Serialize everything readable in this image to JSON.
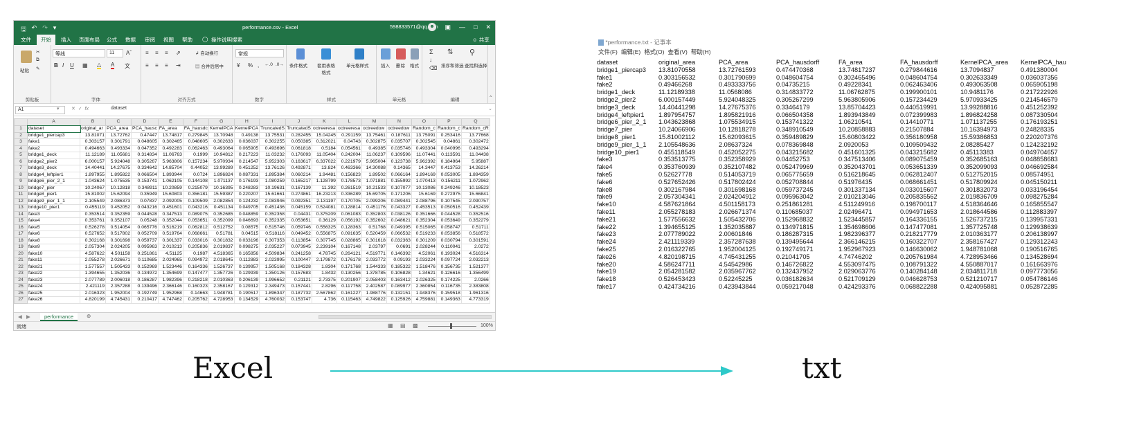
{
  "excel": {
    "title": "performance.csv - Excel",
    "account": "598833571@qq.com",
    "tabs": [
      "文件",
      "开始",
      "插入",
      "页面布局",
      "公式",
      "数据",
      "审阅",
      "视图",
      "帮助"
    ],
    "tell_me": "操作说明搜索",
    "share": "共享",
    "ribbon": {
      "paste": "粘贴",
      "font_name": "等线",
      "font_size": "11",
      "wrap_text": "自动换行",
      "merge_center": "合并后居中",
      "number_format": "常规",
      "conditional_format": "条件格式",
      "format_table": "套用表格格式",
      "cell_styles": "单元格样式",
      "insert": "插入",
      "delete": "删除",
      "format": "格式",
      "sort_filter": "排序和筛选",
      "find_select": "查找和选择",
      "groups": [
        "剪贴板",
        "字体",
        "对齐方式",
        "数字",
        "样式",
        "单元格",
        "编辑"
      ]
    },
    "name_box": "A1",
    "fx": "fx",
    "formula_value": "dataset",
    "columns": [
      "A",
      "B",
      "C",
      "D",
      "E",
      "F",
      "G",
      "H",
      "I",
      "J",
      "K",
      "L",
      "M",
      "N",
      "O",
      "P",
      "Q"
    ],
    "rows": [
      [
        "dataset",
        "original_ar",
        "PCA_area",
        "PCA_hausc",
        "FA_area",
        "FA_hausdc",
        "KernelPCA",
        "KernelPCA",
        "TruncatedS",
        "TruncatedS",
        "octreeresa",
        "octreeresa",
        "octreedow",
        "octreedow",
        "Random_c",
        "Random_c",
        "Random_cR"
      ],
      [
        "bridge1_piercap3",
        "13.81071",
        "13.72762",
        "0.47447",
        "13.74817",
        "0.279845",
        "13.70948",
        "0.49138",
        "13.75531",
        "0.282455",
        "15.04245",
        "0.291159",
        "13.75461",
        "0.187611",
        "13.75091",
        "0.253416",
        "13.77668"
      ],
      [
        "fake1",
        "0.303157",
        "0.301791",
        "0.048605",
        "0.302465",
        "0.048605",
        "0.302633",
        "0.036037",
        "0.302255",
        "0.050385",
        "0.312021",
        "0.04743",
        "0.302875",
        "0.035707",
        "0.302545",
        "0.04861",
        "0.302472"
      ],
      [
        "fake2",
        "0.494663",
        "0.493334",
        "0.047352",
        "0.492283",
        "0.062463",
        "0.493064",
        "0.065905",
        "0.493696",
        "0.061818",
        "0.5184",
        "0.054561",
        "0.49385",
        "0.035746",
        "0.493304",
        "0.040996",
        "0.493294"
      ],
      [
        "bridge1_deck",
        "11.12189",
        "11.05681",
        "0.314834",
        "11.06763",
        "0.1999",
        "10.94812",
        "0.217223",
        "11.03232",
        "0.176093",
        "11.05404",
        "0.242004",
        "11.06237",
        "0.109596",
        "11.07441",
        "0.113591",
        "11.04438"
      ],
      [
        "bridge2_pier2",
        "6.000157",
        "5.924048",
        "0.305267",
        "5.963806",
        "0.157234",
        "5.970934",
        "0.214547",
        "5.952303",
        "0.163617",
        "6.337022",
        "0.221979",
        "5.965004",
        "0.123738",
        "5.962392",
        "0.184964",
        "5.95887"
      ],
      [
        "bridge3_deck",
        "14.40441",
        "14.27675",
        "0.334642",
        "14.85704",
        "0.44052",
        "13.99289",
        "0.451252",
        "13.76126",
        "0.492871",
        "13.824",
        "0.463366",
        "14.30088",
        "0.14365",
        "14.3447",
        "0.413753",
        "14.26214"
      ],
      [
        "bridge4_leftpier1",
        "1.897955",
        "1.895822",
        "0.066504",
        "1.893944",
        "0.0724",
        "1.896824",
        "0.087331",
        "1.895384",
        "0.060214",
        "1.94481",
        "0.156823",
        "1.89502",
        "0.066164",
        "1.894169",
        "0.053005",
        "1.894359"
      ],
      [
        "bridge6_pier_2_1",
        "1.043624",
        "1.075535",
        "0.153741",
        "1.062105",
        "0.144108",
        "1.071137",
        "0.176193",
        "1.080259",
        "0.165217",
        "1.128799",
        "0.178573",
        "1.071881",
        "0.155992",
        "1.070413",
        "0.156211",
        "1.072962"
      ],
      [
        "bridge7_pier",
        "10.24067",
        "10.12818",
        "0.348911",
        "10.20859",
        "0.215079",
        "10.16395",
        "0.248283",
        "10.19631",
        "0.167139",
        "11.392",
        "0.261519",
        "10.21533",
        "0.107077",
        "10.13086",
        "0.249246",
        "10.18523"
      ],
      [
        "bridge8_pier1",
        "15.81002",
        "15.62094",
        "0.35949",
        "15.60803",
        "0.356181",
        "15.59387",
        "0.220207",
        "15.61661",
        "0.274861",
        "16.23213",
        "0.336289",
        "15.69705",
        "0.171206",
        "15.6169",
        "0.272975",
        "15.66841"
      ],
      [
        "bridge9_pier_1_1",
        "2.105549",
        "2.086373",
        "0.07837",
        "2.092005",
        "0.109509",
        "2.082854",
        "0.124232",
        "2.083946",
        "0.092351",
        "2.131197",
        "0.170705",
        "2.099206",
        "0.089441",
        "2.088796",
        "0.107545",
        "2.090757"
      ],
      [
        "bridge10_pier1",
        "0.455119",
        "0.452052",
        "0.043216",
        "0.451601",
        "0.043216",
        "0.451134",
        "0.049705",
        "0.451436",
        "0.045159",
        "0.524081",
        "0.128814",
        "0.451176",
        "0.043327",
        "0.453513",
        "0.050516",
        "0.452439"
      ],
      [
        "fake3",
        "0.353514",
        "0.352359",
        "0.044528",
        "0.347513",
        "0.089075",
        "0.352685",
        "0.048859",
        "0.352358",
        "0.04431",
        "0.375209",
        "0.061083",
        "0.352803",
        "0.038126",
        "0.351666",
        "0.044528",
        "0.352516"
      ],
      [
        "fake4",
        "0.353761",
        "0.352107",
        "0.05248",
        "0.352044",
        "0.053651",
        "0.352099",
        "0.046693",
        "0.352335",
        "0.053651",
        "0.36129",
        "0.056192",
        "0.352602",
        "0.048621",
        "0.352304",
        "0.053649",
        "0.352279"
      ],
      [
        "fake5",
        "0.526278",
        "0.514054",
        "0.065776",
        "0.516219",
        "0.062812",
        "0.512752",
        "0.08575",
        "0.515746",
        "0.059746",
        "0.556325",
        "0.128363",
        "0.51768",
        "0.049395",
        "0.515065",
        "0.058747",
        "0.51711"
      ],
      [
        "fake6",
        "0.527652",
        "0.517802",
        "0.052709",
        "0.519764",
        "0.068661",
        "0.51781",
        "0.04515",
        "0.518116",
        "0.049452",
        "0.556875",
        "0.091635",
        "0.520459",
        "0.066532",
        "0.519233",
        "0.053856",
        "0.518572"
      ],
      [
        "fake8",
        "0.302168",
        "0.301698",
        "0.059737",
        "0.301337",
        "0.033016",
        "0.301832",
        "0.033196",
        "0.307353",
        "0.113854",
        "0.307745",
        "0.028865",
        "0.301618",
        "0.032363",
        "0.301209",
        "0.030794",
        "0.301591"
      ],
      [
        "fake9",
        "2.057304",
        "2.024205",
        "0.095963",
        "2.010213",
        "0.205836",
        "2.019837",
        "0.098275",
        "2.035227",
        "0.073945",
        "2.239104",
        "0.167148",
        "2.03797",
        "0.0691",
        "2.028244",
        "0.110041",
        "2.0272"
      ],
      [
        "fake10",
        "4.587622",
        "4.501158",
        "0.251861",
        "4.51125",
        "0.1987",
        "4.518365",
        "0.165856",
        "4.509834",
        "0.241258",
        "4.78745",
        "0.264121",
        "4.519771",
        "0.146392",
        "4.52061",
        "0.193024",
        "4.516314"
      ],
      [
        "fake11",
        "2.055278",
        "2.026671",
        "0.110685",
        "2.024965",
        "0.094972",
        "2.018645",
        "0.112883",
        "2.023995",
        "0.100447",
        "2.179872",
        "0.176178",
        "2.033772",
        "0.09193",
        "2.033224",
        "0.097724",
        "2.032213"
      ],
      [
        "fake21",
        "1.577557",
        "1.505433",
        "0.152969",
        "1.523446",
        "0.164336",
        "1.526737",
        "0.139957",
        "1.505168",
        "0.184328",
        "1.8304",
        "0.171768",
        "1.544333",
        "0.185322",
        "1.518476",
        "0.156735",
        "1.521377"
      ],
      [
        "fake22",
        "1.394655",
        "1.352036",
        "0.134972",
        "1.354699",
        "0.147477",
        "1.357726",
        "0.129939",
        "1.350126",
        "0.157683",
        "1.8432",
        "0.130256",
        "1.378785",
        "0.106828",
        "1.34621",
        "0.126616",
        "1.356499"
      ],
      [
        "fake23",
        "2.077789",
        "2.006018",
        "0.186287",
        "1.982396",
        "0.218218",
        "2.010363",
        "0.206139",
        "1.996652",
        "0.21121",
        "2.73375",
        "0.201907",
        "2.058403",
        "0.163412",
        "2.026325",
        "0.174225",
        "2.0266"
      ],
      [
        "fake24",
        "2.421119",
        "2.357288",
        "0.139496",
        "2.366146",
        "0.160323",
        "2.358167",
        "0.129312",
        "2.349473",
        "0.157441",
        "2.8296",
        "0.117758",
        "2.402587",
        "0.089977",
        "2.360854",
        "0.116735",
        "2.383808"
      ],
      [
        "fake25",
        "2.016323",
        "1.952004",
        "0.192749",
        "1.952968",
        "0.14663",
        "1.948781",
        "0.190517",
        "1.896347",
        "0.187732",
        "2.567862",
        "0.161227",
        "1.988776",
        "0.132151",
        "1.948376",
        "0.159518",
        "1.961316"
      ],
      [
        "fake26",
        "4.820199",
        "4.745431",
        "0.210417",
        "4.747462",
        "0.205762",
        "4.728953",
        "0.134529",
        "4.760032",
        "0.153747",
        "4.736",
        "0.115463",
        "4.749822",
        "0.125926",
        "4.759881",
        "0.149363",
        "4.773319"
      ]
    ],
    "sheet_tab": "performance",
    "status_left": "就绪",
    "zoom": "100%"
  },
  "notepad": {
    "title": "*performance.txt - 记事本",
    "menu": [
      "文件(F)",
      "编辑(E)",
      "格式(O)",
      "查看(V)",
      "帮助(H)"
    ],
    "header": [
      "dataset",
      "original_area",
      "PCA_area",
      "PCA_hausdorff",
      "FA_area",
      "FA_hausdorff",
      "KernelPCA_area",
      "KernelPCA_hau"
    ],
    "rows": [
      [
        "bridge1_piercap3",
        "13.81070558",
        "13.72761593",
        "0.474470368",
        "13.74817237",
        "0.279844616",
        "13.7094837",
        "0.491380004"
      ],
      [
        "fake1",
        "0.303156532",
        "0.301790699",
        "0.048604754",
        "0.302465496",
        "0.048604754",
        "0.302633349",
        "0.036037356"
      ],
      [
        "fake2",
        "0.49466268",
        "0.493333756",
        "0.04735215",
        "0.49228341",
        "0.062463406",
        "0.493063508",
        "0.065905198"
      ],
      [
        "bridge1_deck",
        "11.12189338",
        "11.0568086",
        "0.314833772",
        "11.06762875",
        "0.199900101",
        "10.9481176",
        "0.217222926"
      ],
      [
        "bridge2_pier2",
        "6.000157449",
        "5.924048325",
        "0.305267299",
        "5.963805906",
        "0.157234429",
        "5.970933425",
        "0.214546579"
      ],
      [
        "bridge3_deck",
        "14.40441298",
        "14.27675376",
        "0.33464179",
        "13.85704423",
        "0.440519991",
        "13.99288816",
        "0.451252392"
      ],
      [
        "bridge4_leftpier1",
        "1.897954757",
        "1.895821916",
        "0.066504358",
        "1.893943849",
        "0.072399983",
        "1.896824258",
        "0.087330504"
      ],
      [
        "bridge6_pier_2_1",
        "1.043623868",
        "1.075534915",
        "0.153741322",
        "1.06210541",
        "0.14410771",
        "1.071137255",
        "0.176193251"
      ],
      [
        "bridge7_pier",
        "10.24066906",
        "10.12818278",
        "0.348910549",
        "10.20858883",
        "0.21507884",
        "10.16394973",
        "0.24828335"
      ],
      [
        "bridge8_pier1",
        "15.81002112",
        "15.62093615",
        "0.359489829",
        "15.60803422",
        "0.356180958",
        "15.59386853",
        "0.220207376"
      ],
      [
        "bridge9_pier_1_1",
        "2.105548636",
        "2.08637324",
        "0.078369848",
        "2.0920053",
        "0.109509432",
        "2.08285427",
        "0.124232192"
      ],
      [
        "bridge10_pier1",
        "0.455118549",
        "0.452052275",
        "0.043215682",
        "0.451601325",
        "0.043215682",
        "0.45113383",
        "0.049704657"
      ],
      [
        "fake3",
        "0.353513775",
        "0.352358929",
        "0.04452753",
        "0.347513406",
        "0.089075459",
        "0.352685163",
        "0.048858683"
      ],
      [
        "fake4",
        "0.353760939",
        "0.352107482",
        "0.052479969",
        "0.352043701",
        "0.053651339",
        "0.352099093",
        "0.046692584"
      ],
      [
        "fake5",
        "0.52627778",
        "0.514053719",
        "0.065775659",
        "0.516218645",
        "0.062812407",
        "0.512752015",
        "0.08574951"
      ],
      [
        "fake6",
        "0.527652426",
        "0.517802424",
        "0.052708844",
        "0.51976435",
        "0.068661451",
        "0.517809924",
        "0.045150211"
      ],
      [
        "fake8",
        "0.302167984",
        "0.301698168",
        "0.059737245",
        "0.301337134",
        "0.033015607",
        "0.301832073",
        "0.033196454"
      ],
      [
        "fake9",
        "2.057304341",
        "2.024204912",
        "0.095963042",
        "2.010213046",
        "0.205835562",
        "2.019836709",
        "0.098275284"
      ],
      [
        "fake10",
        "4.587621864",
        "4.501158173",
        "0.251861281",
        "4.511249916",
        "0.198700117",
        "4.518364646",
        "0.165855547"
      ],
      [
        "fake11",
        "2.055278183",
        "2.026671374",
        "0.110685037",
        "2.02496471",
        "0.094971653",
        "2.018644586",
        "0.112883397"
      ],
      [
        "fake21",
        "1.577556632",
        "1.505432706",
        "0.152968832",
        "1.523445857",
        "0.164336155",
        "1.526737215",
        "0.139957331"
      ],
      [
        "fake22",
        "1.394655125",
        "1.352035887",
        "0.134971815",
        "1.354698606",
        "0.147477081",
        "1.357725748",
        "0.129938639"
      ],
      [
        "fake23",
        "2.077789022",
        "2.00601846",
        "0.186287315",
        "1.982396377",
        "0.218217779",
        "2.010363177",
        "0.206138997"
      ],
      [
        "fake24",
        "2.421119339",
        "2.357287638",
        "0.139495644",
        "2.366146215",
        "0.160322707",
        "2.358167427",
        "0.129312243"
      ],
      [
        "fake25",
        "2.016322765",
        "1.952004125",
        "0.192749171",
        "1.952967923",
        "0.146630062",
        "1.948781068",
        "0.190516765"
      ],
      [
        "fake26",
        "4.820198715",
        "4.745431255",
        "0.21041705",
        "4.74746202",
        "0.205761984",
        "4.728953466",
        "0.134528694"
      ],
      [
        "fake20",
        "4.586247711",
        "4.54542986",
        "0.146726822",
        "4.553097475",
        "0.108791322",
        "4.550887017",
        "0.161663976"
      ],
      [
        "fake19",
        "2.054281582",
        "2.035967762",
        "0.132437952",
        "2.029063776",
        "0.140284148",
        "2.034811718",
        "0.097773056"
      ],
      [
        "fake18",
        "0.526453423",
        "0.52245225",
        "0.036182634",
        "0.521709129",
        "0.046628753",
        "0.521210717",
        "0.054786146"
      ],
      [
        "fake17",
        "0.424734216",
        "0.423943844",
        "0.059217048",
        "0.424293376",
        "0.068822288",
        "0.424095881",
        "0.052872285"
      ]
    ]
  },
  "labels": {
    "left": "Excel",
    "right": "txt"
  },
  "colors": {
    "excel_green": "#217346",
    "arrow": "#2ec9c9"
  }
}
